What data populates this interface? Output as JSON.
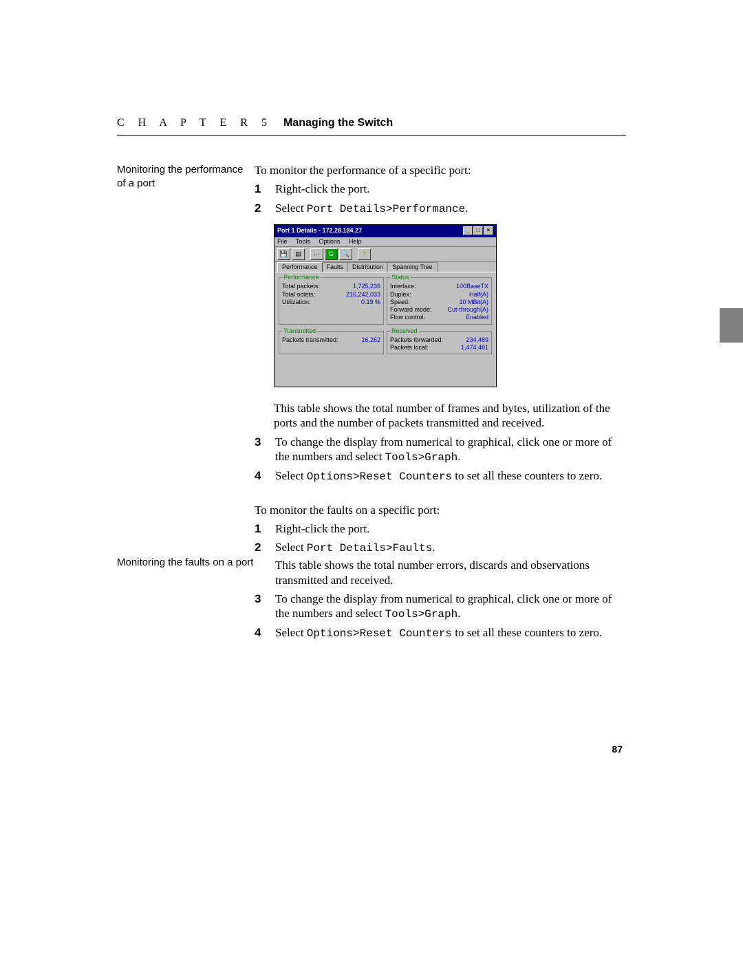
{
  "header": {
    "chapter_spaced": "C H A P T E R 5",
    "title": "Managing the Switch"
  },
  "side": {
    "s1": "Monitoring the performance of a port",
    "s2": "Monitoring the faults on a port"
  },
  "section1": {
    "intro": "To monitor the performance of a specific port:",
    "step1": "Right-click the port.",
    "step2_a": "Select ",
    "step2_code": "Port Details>Performance",
    "step2_c": ".",
    "after_img": "This table shows the total number of frames and bytes, utilization of the ports and the number of packets transmitted and received.",
    "step3_a": "To change the display from numerical to graphical, click one or more of the numbers and select ",
    "step3_code": "Tools>Graph",
    "step3_c": ".",
    "step4_a": "Select ",
    "step4_code": "Options>Reset Counters",
    "step4_c": " to set all these counters to zero."
  },
  "section2": {
    "intro": "To monitor the faults on a specific port:",
    "step1": "Right-click the port.",
    "step2_a": "Select ",
    "step2_code": "Port Details>Faults",
    "step2_c": ".",
    "step2_para": "This table shows the total number errors, discards and observations transmitted and received.",
    "step3_a": "To change the display from numerical to graphical, click one or more of the numbers and select ",
    "step3_code": "Tools>Graph",
    "step3_c": ".",
    "step4_a": "Select ",
    "step4_code": "Options>Reset Counters",
    "step4_c": " to set all these counters to zero."
  },
  "screenshot": {
    "title": "Port 1 Details - 172.28.184.27",
    "menu": {
      "file": "File",
      "tools": "Tools",
      "options": "Options",
      "help": "Help"
    },
    "tabs": {
      "performance": "Performance",
      "faults": "Faults",
      "distribution": "Distribution",
      "spanning": "Spanning Tree"
    },
    "group_performance": {
      "legend": "Performance",
      "r1l": "Total packets:",
      "r1v": "1,725,236",
      "r2l": "Total octets:",
      "r2v": "216,242,033",
      "r3l": "Utilization:",
      "r3v": "0.19 %"
    },
    "group_status": {
      "legend": "Status",
      "r1l": "Interface:",
      "r1v": "100BaseTX",
      "r2l": "Duplex:",
      "r2v": "Half(A)",
      "r3l": "Speed:",
      "r3v": "10 MBit(A)",
      "r4l": "Forward mode:",
      "r4v": "Cut-through(A)",
      "r5l": "Flow control:",
      "r5v": "Enabled"
    },
    "group_tx": {
      "legend": "Transmitted",
      "r1l": "Packets transmitted:",
      "r1v": "16,262"
    },
    "group_rx": {
      "legend": "Received",
      "r1l": "Packets forwarded:",
      "r1v": "234,489",
      "r2l": "Packets local:",
      "r2v": "1,474,481"
    },
    "winbtn": {
      "min": "_",
      "max": "□",
      "close": "×"
    }
  },
  "page_number": "87",
  "nums": {
    "n1": "1",
    "n2": "2",
    "n3": "3",
    "n4": "4"
  }
}
